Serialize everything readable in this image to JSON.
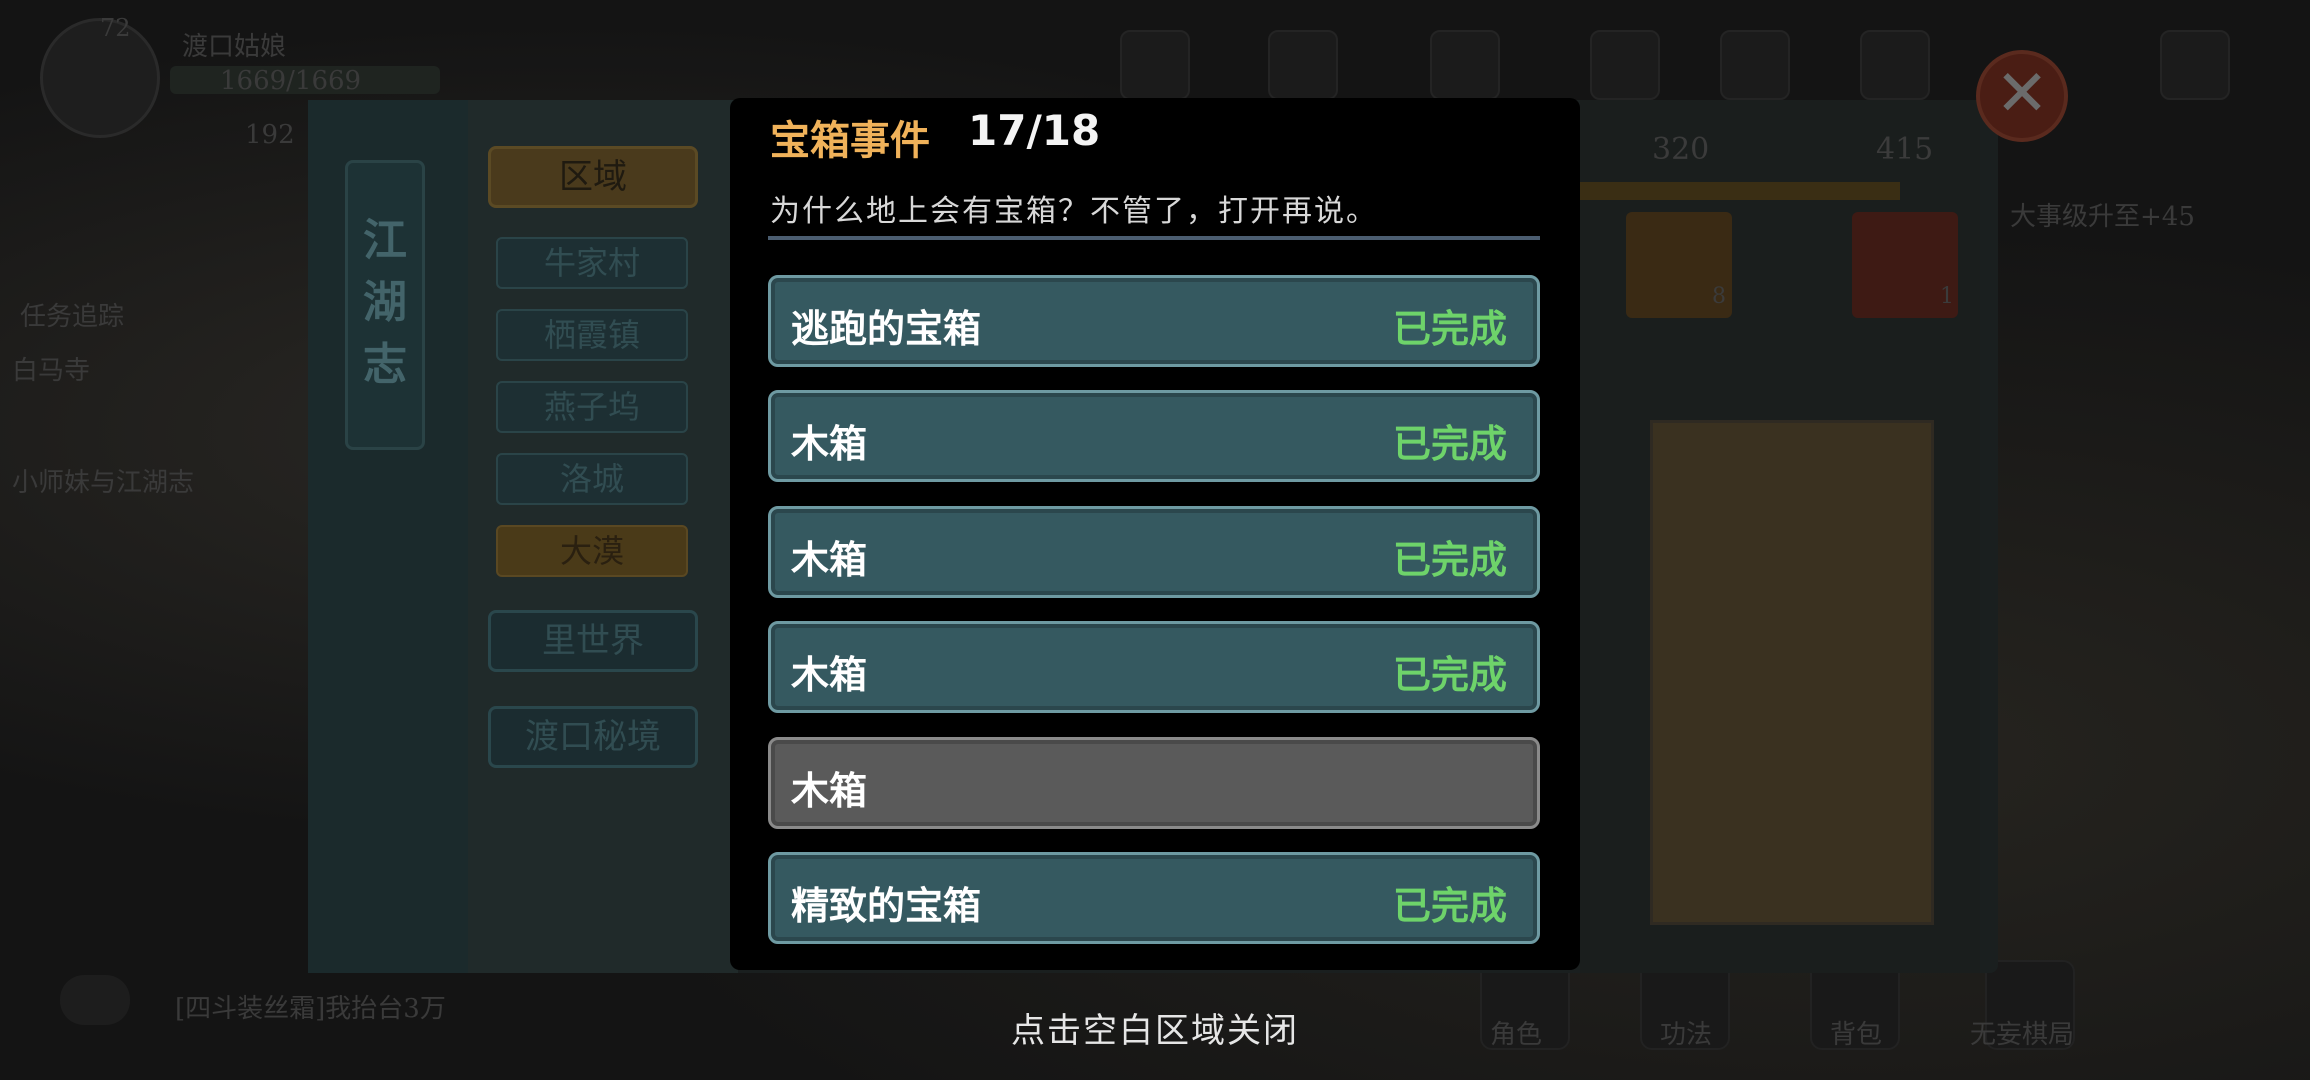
{
  "background": {
    "player_name": "渡口姑娘",
    "hp": "1669/1669",
    "level": "72",
    "currency": "192",
    "quest_header": "任务追踪",
    "quest_items": [
      "白马寺",
      "小师妹与江湖志"
    ],
    "chat_text": "[四斗装丝霜]我抬台3万",
    "bottom_menu": [
      "角色",
      "功法",
      "背包",
      "无妄棋局"
    ],
    "stat_values": [
      "320",
      "415"
    ],
    "card_counts": [
      "8",
      "1"
    ],
    "side_text": "大事级升至+45"
  },
  "journal": {
    "spine_title": "江湖志",
    "region_label": "区域",
    "regions": [
      "牛家村",
      "栖霞镇",
      "燕子坞",
      "洛城",
      "大漠"
    ],
    "active_region": "大漠",
    "other_buttons": [
      "里世界",
      "渡口秘境"
    ]
  },
  "modal": {
    "title": "宝箱事件",
    "count": "17/18",
    "description": "为什么地上会有宝箱？不管了，打开再说。",
    "items": [
      {
        "label": "逃跑的宝箱",
        "status": "已完成"
      },
      {
        "label": "木箱",
        "status": "已完成"
      },
      {
        "label": "木箱",
        "status": "已完成"
      },
      {
        "label": "木箱",
        "status": "已完成"
      },
      {
        "label": "木箱",
        "status": ""
      },
      {
        "label": "精致的宝箱",
        "status": "已完成"
      }
    ],
    "close_hint": "点击空白区域关闭"
  },
  "colors": {
    "title_accent": "#f0b25a",
    "completed_status": "#6ed36a",
    "row_completed": "#355960",
    "row_pending": "#5a5a5a"
  },
  "icons": {
    "close": "close-x-icon"
  }
}
